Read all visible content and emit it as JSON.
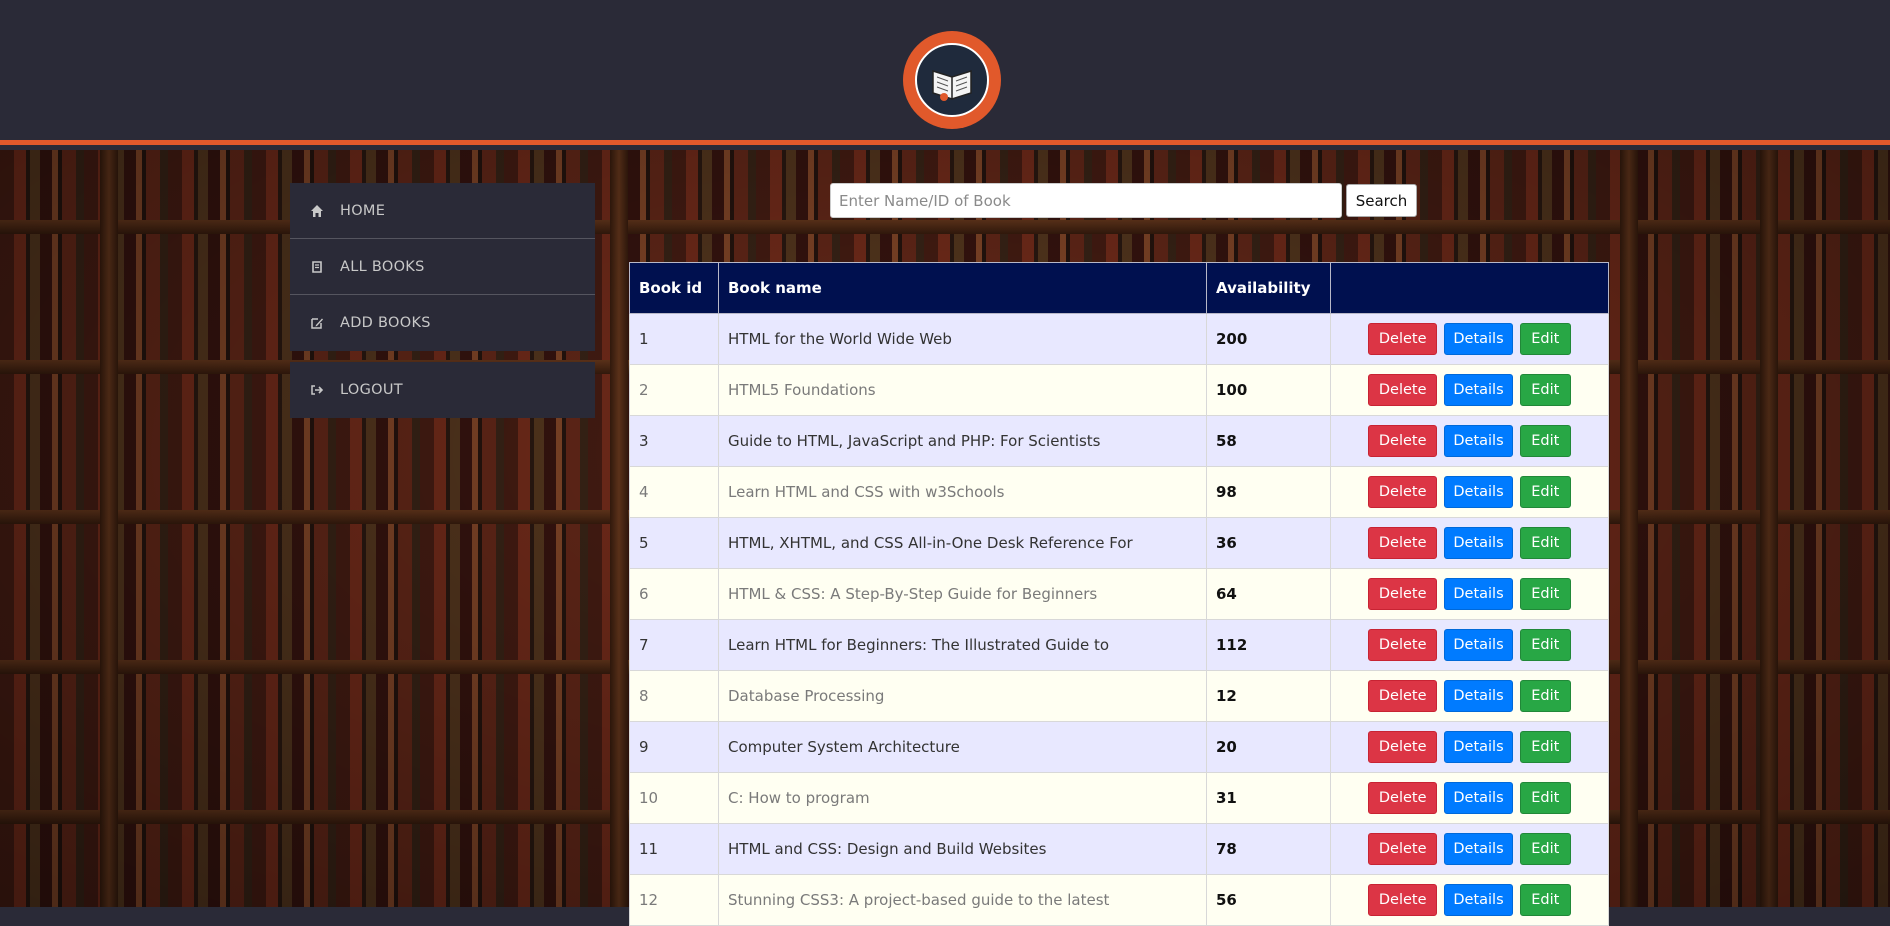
{
  "logo": {
    "icon": "library-system-logo",
    "colors": {
      "ring": "#e1592b",
      "inner": "#1f2a3c"
    }
  },
  "colors": {
    "header": "#2a2a37",
    "accent": "#e1592b",
    "table_header": "#00104f"
  },
  "sidebar": {
    "items": [
      {
        "label": "HOME",
        "icon": "home-icon"
      },
      {
        "label": "ALL BOOKS",
        "icon": "book-icon"
      },
      {
        "label": "ADD BOOKS",
        "icon": "edit-icon"
      },
      {
        "label": "LOGOUT",
        "icon": "logout-icon"
      }
    ]
  },
  "search": {
    "placeholder": "Enter Name/ID of Book",
    "value": "",
    "button_label": "Search"
  },
  "table": {
    "headers": [
      "Book id",
      "Book name",
      "Availability",
      ""
    ],
    "actions": {
      "delete": "Delete",
      "details": "Details",
      "edit": "Edit"
    },
    "rows": [
      {
        "id": "1",
        "name": "HTML for the World Wide Web",
        "availability": "200"
      },
      {
        "id": "2",
        "name": "HTML5 Foundations",
        "availability": "100"
      },
      {
        "id": "3",
        "name": "Guide to HTML, JavaScript and PHP: For Scientists",
        "availability": "58"
      },
      {
        "id": "4",
        "name": "Learn HTML and CSS with w3Schools",
        "availability": "98"
      },
      {
        "id": "5",
        "name": "HTML, XHTML, and CSS All-in-One Desk Reference For",
        "availability": "36"
      },
      {
        "id": "6",
        "name": "HTML & CSS: A Step-By-Step Guide for Beginners",
        "availability": "64"
      },
      {
        "id": "7",
        "name": "Learn HTML for Beginners: The Illustrated Guide to",
        "availability": "112"
      },
      {
        "id": "8",
        "name": "Database Processing",
        "availability": "12"
      },
      {
        "id": "9",
        "name": "Computer System Architecture",
        "availability": "20"
      },
      {
        "id": "10",
        "name": "C: How to program",
        "availability": "31"
      },
      {
        "id": "11",
        "name": "HTML and CSS: Design and Build Websites",
        "availability": "78"
      },
      {
        "id": "12",
        "name": "Stunning CSS3: A project-based guide to the latest",
        "availability": "56"
      }
    ]
  }
}
